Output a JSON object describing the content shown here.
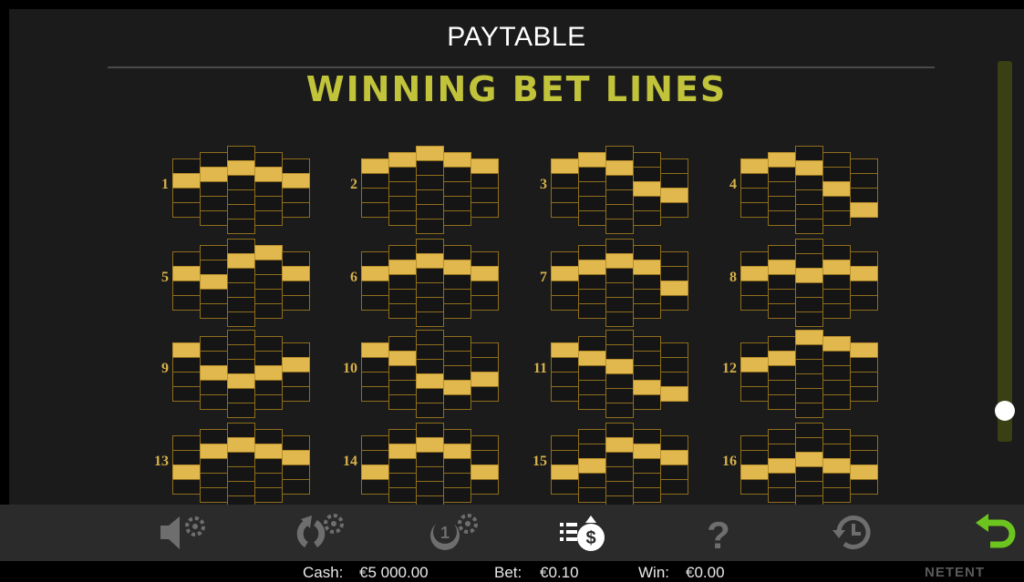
{
  "header": {
    "title": "PAYTABLE",
    "subtitle": "WINNING BET LINES"
  },
  "lines": [
    {
      "label": "1",
      "pattern": [
        1,
        1,
        1,
        1,
        1
      ]
    },
    {
      "label": "2",
      "pattern": [
        0,
        0,
        0,
        0,
        0
      ]
    },
    {
      "label": "3",
      "pattern": [
        0,
        0,
        1,
        2,
        2
      ]
    },
    {
      "label": "4",
      "pattern": [
        0,
        0,
        1,
        2,
        3
      ]
    },
    {
      "label": "5",
      "pattern": [
        1,
        2,
        1,
        0,
        1
      ]
    },
    {
      "label": "6",
      "pattern": [
        1,
        1,
        1,
        1,
        1
      ]
    },
    {
      "label": "7",
      "pattern": [
        1,
        1,
        1,
        1,
        2
      ]
    },
    {
      "label": "8",
      "pattern": [
        1,
        1,
        2,
        1,
        1
      ]
    },
    {
      "label": "9",
      "pattern": [
        0,
        2,
        3,
        2,
        1
      ]
    },
    {
      "label": "10",
      "pattern": [
        0,
        1,
        3,
        3,
        2
      ]
    },
    {
      "label": "11",
      "pattern": [
        0,
        1,
        2,
        3,
        3
      ]
    },
    {
      "label": "12",
      "pattern": [
        1,
        1,
        0,
        0,
        0
      ]
    },
    {
      "label": "13",
      "pattern": [
        2,
        1,
        1,
        1,
        1
      ]
    },
    {
      "label": "14",
      "pattern": [
        2,
        1,
        1,
        1,
        2
      ]
    },
    {
      "label": "15",
      "pattern": [
        2,
        2,
        1,
        1,
        1
      ]
    },
    {
      "label": "16",
      "pattern": [
        2,
        2,
        2,
        2,
        2
      ]
    }
  ],
  "toolbar": {
    "buttons": [
      {
        "name": "sound-settings-icon"
      },
      {
        "name": "autoplay-settings-icon"
      },
      {
        "name": "coin-settings-icon"
      },
      {
        "name": "paytable-icon",
        "active": true
      },
      {
        "name": "help-icon"
      },
      {
        "name": "history-icon"
      },
      {
        "name": "back-icon"
      }
    ],
    "icon_color": "#6e6e6e",
    "active_color": "#ffffff",
    "back_color": "#6cc51e"
  },
  "status": {
    "cash_label": "Cash:",
    "cash_value": "€5 000.00",
    "bet_label": "Bet:",
    "bet_value": "€0.10",
    "win_label": "Win:",
    "win_value": "€0.00",
    "brand": "NETENT"
  },
  "colors": {
    "accent": "#c1c33a",
    "win_cell": "#e1b84d",
    "cell_border": "#8f6e1c"
  }
}
